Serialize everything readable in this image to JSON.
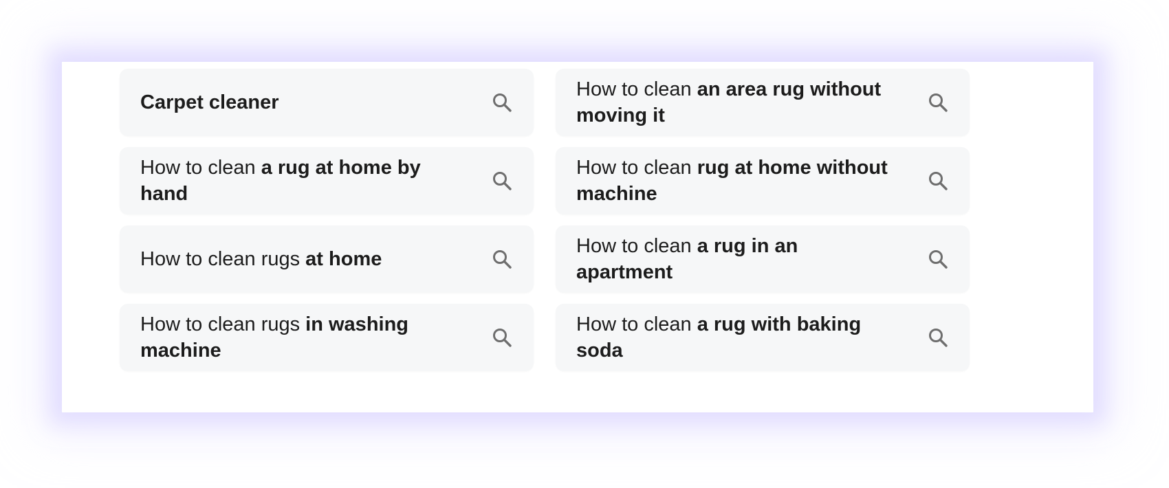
{
  "suggestions": [
    {
      "prefix": "",
      "bold": "Carpet cleaner",
      "icon": "search-icon"
    },
    {
      "prefix": "How to clean ",
      "bold": "an area rug without moving it",
      "icon": "search-icon"
    },
    {
      "prefix": "How to clean ",
      "bold": "a rug at home by hand",
      "icon": "search-icon"
    },
    {
      "prefix": "How to clean ",
      "bold": "rug at home without machine",
      "icon": "search-icon"
    },
    {
      "prefix": "How to clean rugs ",
      "bold": "at home",
      "icon": "search-icon"
    },
    {
      "prefix": "How to clean ",
      "bold": "a rug in an apartment",
      "icon": "search-icon"
    },
    {
      "prefix": "How to clean rugs ",
      "bold": "in washing machine",
      "icon": "search-icon"
    },
    {
      "prefix": "How to clean ",
      "bold": "a rug with baking soda",
      "icon": "search-icon"
    }
  ],
  "colors": {
    "chip_background": "#f6f7f8",
    "text": "#1c1c1c",
    "icon": "#6e6e6e",
    "glow": "#d4ccff"
  }
}
